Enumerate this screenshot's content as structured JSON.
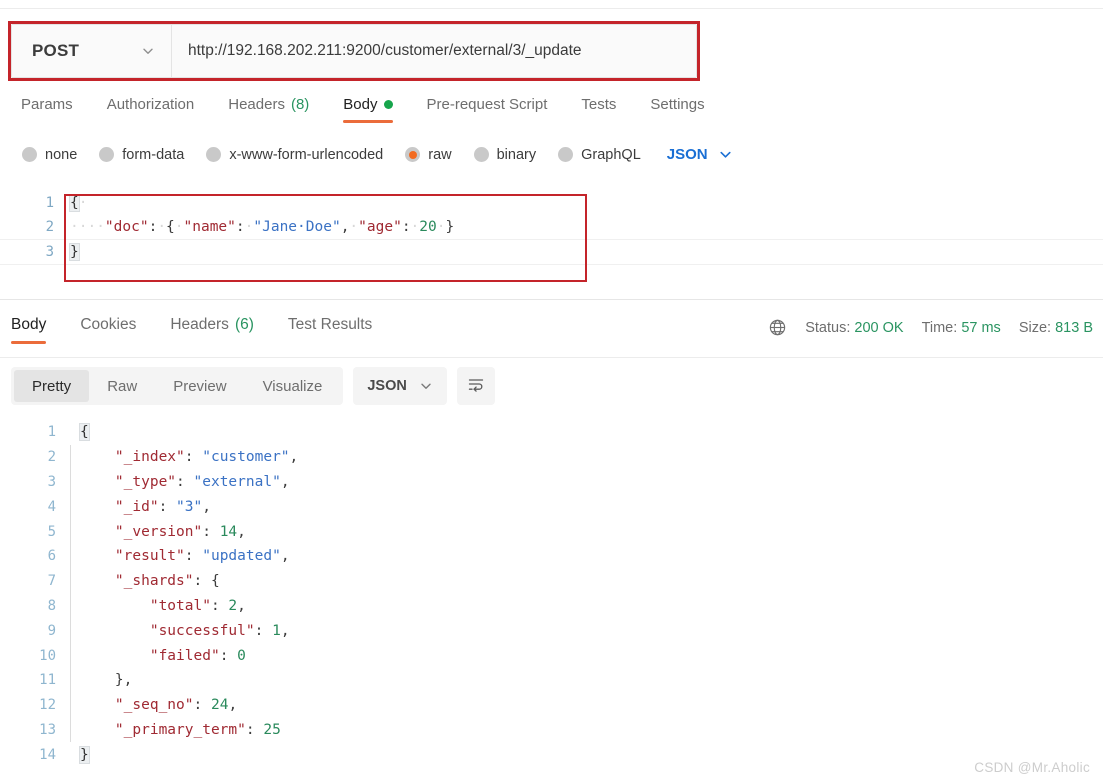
{
  "request": {
    "method": "POST",
    "method_chevron_icon": "chevron-down-icon",
    "url": "http://192.168.202.211:9200/customer/external/3/_update",
    "tabs": [
      {
        "label": "Params",
        "count": "",
        "active": false,
        "dot": false
      },
      {
        "label": "Authorization",
        "count": "",
        "active": false,
        "dot": false
      },
      {
        "label": "Headers",
        "count": "(8)",
        "active": false,
        "dot": false
      },
      {
        "label": "Body",
        "count": "",
        "active": true,
        "dot": true
      },
      {
        "label": "Pre-request Script",
        "count": "",
        "active": false,
        "dot": false
      },
      {
        "label": "Tests",
        "count": "",
        "active": false,
        "dot": false
      },
      {
        "label": "Settings",
        "count": "",
        "active": false,
        "dot": false
      }
    ],
    "body_types": [
      {
        "label": "none",
        "selected": false
      },
      {
        "label": "form-data",
        "selected": false
      },
      {
        "label": "x-www-form-urlencoded",
        "selected": false
      },
      {
        "label": "raw",
        "selected": true
      },
      {
        "label": "binary",
        "selected": false
      },
      {
        "label": "GraphQL",
        "selected": false
      }
    ],
    "format": "JSON",
    "format_chevron_icon": "chevron-down-icon",
    "body_lines": [
      {
        "n": "1",
        "text": "{"
      },
      {
        "n": "2",
        "text": "    \"doc\": { \"name\": \"Jane Doe\", \"age\": 20 }"
      },
      {
        "n": "3",
        "text": "}"
      }
    ]
  },
  "response": {
    "tabs": [
      {
        "label": "Body",
        "count": "",
        "active": true
      },
      {
        "label": "Cookies",
        "count": "",
        "active": false
      },
      {
        "label": "Headers",
        "count": "(6)",
        "active": false
      },
      {
        "label": "Test Results",
        "count": "",
        "active": false
      }
    ],
    "globe_icon": "globe-icon",
    "status_label": "Status:",
    "status_value": "200 OK",
    "time_label": "Time:",
    "time_value": "57 ms",
    "size_label": "Size:",
    "size_value": "813 B",
    "view_modes": [
      {
        "label": "Pretty",
        "active": true
      },
      {
        "label": "Raw",
        "active": false
      },
      {
        "label": "Preview",
        "active": false
      },
      {
        "label": "Visualize",
        "active": false
      }
    ],
    "format": "JSON",
    "format_chevron_icon": "chevron-down-icon",
    "wrap_icon": "word-wrap-icon",
    "body_lines": [
      {
        "n": "1",
        "text": "{"
      },
      {
        "n": "2",
        "text": "    \"_index\": \"customer\","
      },
      {
        "n": "3",
        "text": "    \"_type\": \"external\","
      },
      {
        "n": "4",
        "text": "    \"_id\": \"3\","
      },
      {
        "n": "5",
        "text": "    \"_version\": 14,"
      },
      {
        "n": "6",
        "text": "    \"result\": \"updated\","
      },
      {
        "n": "7",
        "text": "    \"_shards\": {"
      },
      {
        "n": "8",
        "text": "        \"total\": 2,"
      },
      {
        "n": "9",
        "text": "        \"successful\": 1,"
      },
      {
        "n": "10",
        "text": "        \"failed\": 0"
      },
      {
        "n": "11",
        "text": "    },"
      },
      {
        "n": "12",
        "text": "    \"_seq_no\": 24,"
      },
      {
        "n": "13",
        "text": "    \"_primary_term\": 25"
      },
      {
        "n": "14",
        "text": "}"
      }
    ]
  },
  "watermark": "CSDN @Mr.Aholic",
  "colors": {
    "accent_orange": "#eb6c3b",
    "annotation_red": "#c4242a",
    "status_green": "#2a9461",
    "link_blue": "#1a6fd4",
    "json_key": "#a02a33",
    "json_string": "#3b72c4",
    "json_number": "#2a8a5c"
  }
}
